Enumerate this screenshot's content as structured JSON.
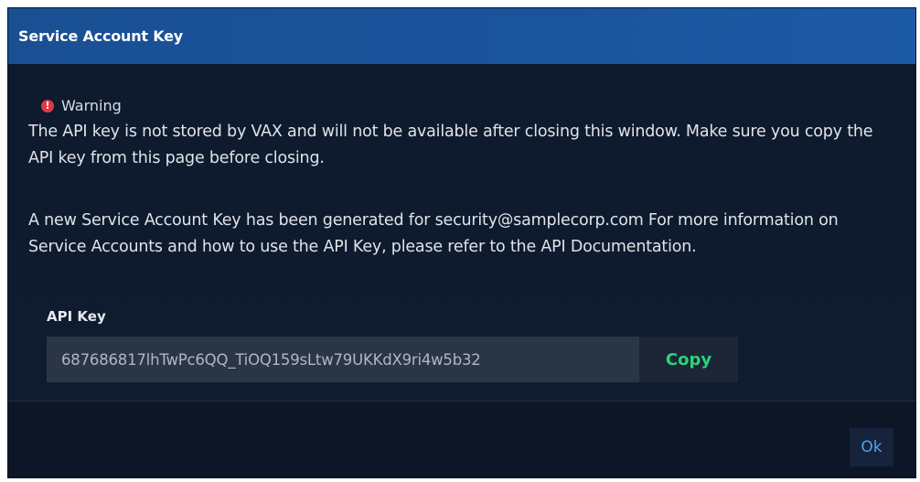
{
  "dialog": {
    "title": "Service Account Key",
    "warning": {
      "icon": "exclamation-circle-icon",
      "icon_glyph": "!",
      "label": "Warning",
      "color": "#e0384a"
    },
    "warning_text": "The API key is not stored by VAX and will not be available after closing this window. Make sure you copy the API key from this page before closing.",
    "info_text": "A new Service Account Key has been generated for security@samplecorp.com For more information on Service Accounts and how to use the API Key, please refer to the API Documentation.",
    "api_key": {
      "label": "API Key",
      "value": "687686817lhTwPc6QQ_TiOQ159sLtw79UKKdX9ri4w5b32",
      "copy_label": "Copy"
    },
    "ok_label": "Ok"
  },
  "colors": {
    "title_bar": "#1a549c",
    "background": "#0f1a2e",
    "copy_accent": "#2bd47a",
    "ok_accent": "#4aa3f0"
  }
}
